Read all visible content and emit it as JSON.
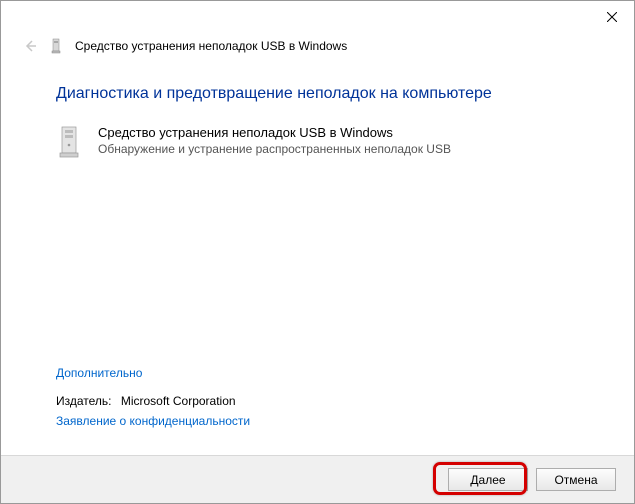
{
  "window": {
    "title": "Средство устранения неполадок USB в Windows"
  },
  "main": {
    "heading": "Диагностика и предотвращение неполадок на компьютере",
    "item_title": "Средство устранения неполадок USB в Windows",
    "item_desc": "Обнаружение и устранение распространенных неполадок USB"
  },
  "links": {
    "advanced": "Дополнительно",
    "privacy": "Заявление о конфиденциальности"
  },
  "publisher": {
    "label": "Издатель:",
    "value": "Microsoft Corporation"
  },
  "buttons": {
    "next": "Далее",
    "cancel": "Отмена"
  }
}
